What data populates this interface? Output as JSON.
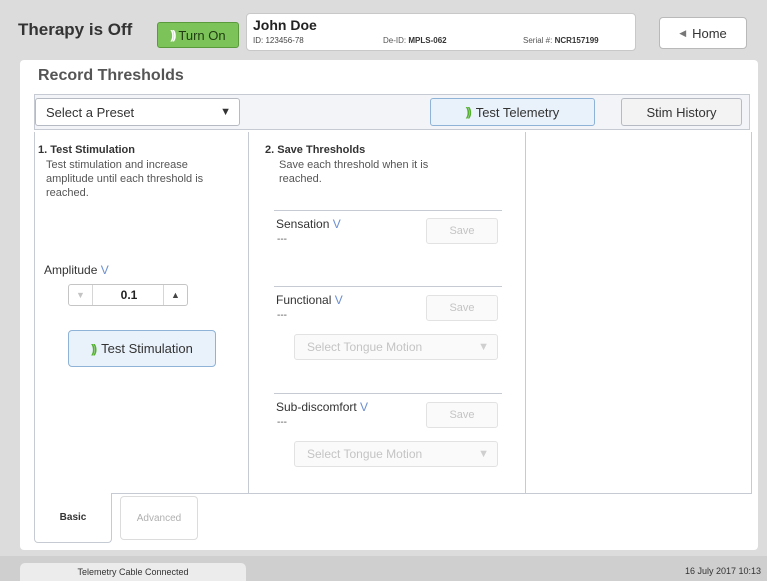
{
  "header": {
    "therapy_status": "Therapy is Off",
    "turn_on_label": "Turn On",
    "home_label": "Home"
  },
  "patient": {
    "name": "John Doe",
    "id_label": "ID:",
    "id_value": "123456-78",
    "deid_label": "De-ID:",
    "deid_value": "MPLS-062",
    "serial_label": "Serial #:",
    "serial_value": "NCR157199"
  },
  "page": {
    "title": "Record Thresholds"
  },
  "toolbar": {
    "preset_placeholder": "Select a Preset",
    "test_telemetry_label": "Test Telemetry",
    "stim_history_label": "Stim History"
  },
  "step1": {
    "title": "1. Test Stimulation",
    "description": "Test stimulation and increase amplitude until each threshold is reached.",
    "amplitude_label": "Amplitude",
    "amplitude_unit": "V",
    "amplitude_value": "0.1",
    "test_stimulation_label": "Test Stimulation"
  },
  "step2": {
    "title": "2. Save Thresholds",
    "description": "Save each threshold when it is reached.",
    "save_label": "Save",
    "tongue_motion_placeholder": "Select Tongue Motion",
    "thresholds": [
      {
        "label": "Sensation",
        "unit": "V",
        "value": "---"
      },
      {
        "label": "Functional",
        "unit": "V",
        "value": "---"
      },
      {
        "label": "Sub-discomfort",
        "unit": "V",
        "value": "---"
      }
    ]
  },
  "tabs": [
    {
      "label": "Basic",
      "active": true
    },
    {
      "label": "Advanced",
      "active": false
    }
  ],
  "status_bar": {
    "connection": "Telemetry Cable Connected",
    "datetime": "16 July 2017 10:13"
  },
  "colors": {
    "turn_on_green": "#7cc35a",
    "telemetry_wave_green": "#55b030",
    "unit_blue": "#6c8fd0",
    "button_blue_bg": "#e9f2fb"
  },
  "icons": {
    "telemetry": "wireless-wave-icon",
    "home_arrow": "triangle-left-icon",
    "dropdown": "triangle-down-icon",
    "stepper_down": "triangle-down-icon",
    "stepper_up": "triangle-up-icon"
  }
}
